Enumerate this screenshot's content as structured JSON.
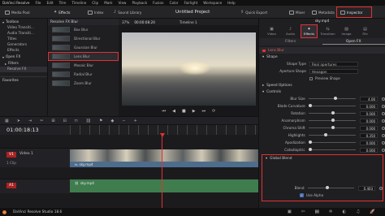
{
  "menubar": {
    "items": [
      "DaVinci Resolve",
      "File",
      "Edit",
      "Trim",
      "Timeline",
      "Clip",
      "Mark",
      "View",
      "Playback",
      "Fusion",
      "Color",
      "Fairlight",
      "Workspace",
      "Help"
    ]
  },
  "toolbar": {
    "media_pool": "Media Pool",
    "effects": "Effects",
    "index": "Index",
    "sound_library": "Sound Library",
    "zoom": "37%",
    "timecode": "00:00:08:20",
    "timeline_name": "Timeline 1",
    "project_title": "Untitled Project",
    "quick_export": "Quick Export",
    "mixer": "Mixer",
    "metadata": "Metadata",
    "inspector": "Inspector"
  },
  "effects_sidebar": {
    "toolbox": "Toolbox",
    "items": [
      "Video Transiti...",
      "Audio Transiti...",
      "Titles",
      "Generators",
      "Effects"
    ],
    "open_fx": "Open FX",
    "filters": "Filters",
    "resolve_fx": "Resolve FX",
    "favorites": "Favorites"
  },
  "fx_list": {
    "header": "Resolve FX Blur",
    "items": [
      "Box Blur",
      "Directional Blur",
      "Gaussian Blur",
      "Lens Blur",
      "Mosaic Blur",
      "Radial Blur",
      "Zoom Blur"
    ],
    "selected": "Lens Blur"
  },
  "timeline": {
    "timecode": "01:00:18:13",
    "v1_label": "V1",
    "v1_name": "Video 1",
    "v1_clip_count": "1 Clip",
    "a1_label": "A1",
    "video_clip": "sky.mp4",
    "audio_clip": "sky.mp4"
  },
  "inspector": {
    "clip_name": "sky.mp4",
    "tabs": [
      "Video",
      "Audio",
      "Effects",
      "Transition",
      "Image",
      "File"
    ],
    "active_tab": "Effects",
    "subtabs": [
      "Filters",
      "Open FX"
    ],
    "effect_name": "Lens Blur",
    "section_shape": "Shape",
    "shape_type_label": "Shape Type",
    "shape_type_value": "Real apertures",
    "aperture_shape_label": "Aperture Shape",
    "aperture_shape_value": "Hexagon",
    "preview_shape": "Preview Shape",
    "section_speed": "Speed Options",
    "section_controls": "Controls",
    "params": [
      {
        "label": "Blur Size",
        "value": "4.00",
        "fill": 0.55
      },
      {
        "label": "Blade Curvature",
        "value": "0.000",
        "fill": 0.0
      },
      {
        "label": "Rotation",
        "value": "0.000",
        "fill": 0.5
      },
      {
        "label": "Anamorphism",
        "value": "0.000",
        "fill": 0.5
      },
      {
        "label": "Chroma Shift",
        "value": "0.000",
        "fill": 0.5
      },
      {
        "label": "Highlights",
        "value": "0.350",
        "fill": 0.35
      },
      {
        "label": "Apodization",
        "value": "0.000",
        "fill": 0.0
      },
      {
        "label": "Catadioptric",
        "value": "0.000",
        "fill": 0.0
      }
    ],
    "section_global_blend": "Global Blend",
    "blend_label": "Blend",
    "blend_value": "0.403",
    "blend_fill": 0.403,
    "use_alpha": "Use Alpha"
  },
  "statusbar": {
    "app_name": "DaVinci Resolve Studio 18.6"
  },
  "colors": {
    "accent_red": "#e53030",
    "video_clip": "#4d6d8d",
    "audio_clip": "#3f7d4e"
  }
}
